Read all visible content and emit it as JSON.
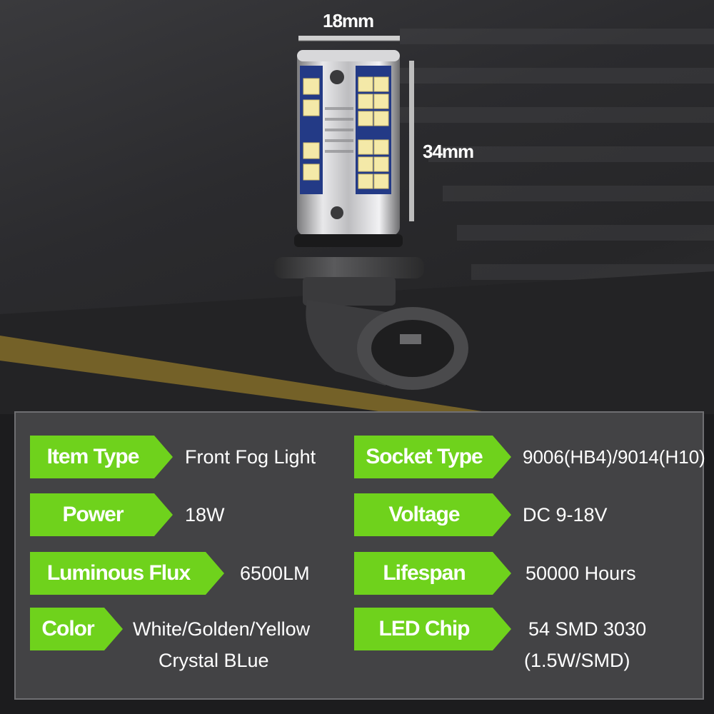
{
  "dimensions": {
    "width_label": "18mm",
    "height_label": "34mm"
  },
  "colors": {
    "tag_green": "#6fd21c",
    "panel_bg": "#434345",
    "road_line": "#b8962b"
  },
  "specs": {
    "item_type": {
      "label": "Item Type",
      "value": "Front Fog Light"
    },
    "socket_type": {
      "label": "Socket Type",
      "value": "9006(HB4)/9014(H10)"
    },
    "power": {
      "label": "Power",
      "value": "18W"
    },
    "voltage": {
      "label": "Voltage",
      "value": "DC  9-18V"
    },
    "luminous_flux": {
      "label": "Luminous Flux",
      "value": "6500LM"
    },
    "lifespan": {
      "label": "Lifespan",
      "value": "50000 Hours"
    },
    "color": {
      "label": "Color",
      "value_line1": "White/Golden/Yellow",
      "value_line2": "Crystal BLue"
    },
    "led_chip": {
      "label": "LED  Chip",
      "value_line1": "54 SMD 3030",
      "value_line2": "(1.5W/SMD)"
    }
  }
}
